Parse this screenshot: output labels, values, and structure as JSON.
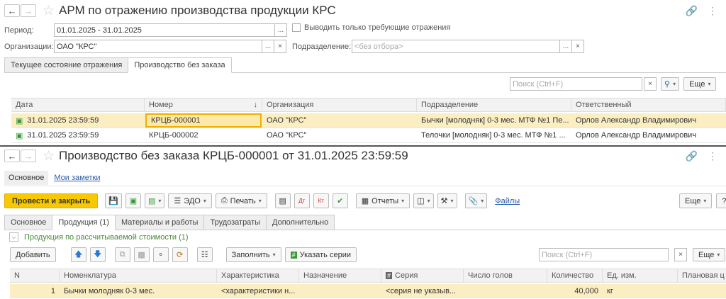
{
  "w1": {
    "title": "АРМ по отражению производства продукции КРС",
    "period_label": "Период:",
    "period_value": "01.01.2025 - 31.01.2025",
    "only_required_label": "Выводить только требующие отражения",
    "org_label": "Организации:",
    "org_value": "ОАО \"КРС\"",
    "dept_label": "Подразделение:",
    "dept_placeholder": "<без отбора>",
    "tabs": [
      "Текущее состояние отражения",
      "Производство без заказа"
    ],
    "search_placeholder": "Поиск (Ctrl+F)",
    "more_label": "Еще",
    "columns": [
      "Дата",
      "Номер",
      "Организация",
      "Подразделение",
      "Ответственный"
    ],
    "rows": [
      {
        "date": "31.01.2025 23:59:59",
        "number": "КРЦБ-000001",
        "org": "ОАО \"КРС\"",
        "dept": "Бычки [молодняк] 0-3 мес. МТФ №1 Пе...",
        "resp": "Орлов Александр Владимирович"
      },
      {
        "date": "31.01.2025 23:59:59",
        "number": "КРЦБ-000002",
        "org": "ОАО \"КРС\"",
        "dept": "Телочки [молодняк] 0-3 мес. МТФ №1 ...",
        "resp": "Орлов Александр Владимирович"
      }
    ]
  },
  "w2": {
    "title": "Производство без заказа КРЦБ-000001 от 31.01.2025 23:59:59",
    "nav": [
      "Основное",
      "Мои заметки"
    ],
    "toolbar": {
      "post_close": "Провести и закрыть",
      "edo": "ЭДО",
      "print": "Печать",
      "reports": "Отчеты",
      "files": "Файлы",
      "more": "Еще",
      "help": "?"
    },
    "tabs": [
      "Основное",
      "Продукция (1)",
      "Материалы и работы",
      "Трудозатраты",
      "Дополнительно"
    ],
    "group_label": "Продукция по рассчитываемой стоимости (1)",
    "grid_toolbar": {
      "add": "Добавить",
      "fill": "Заполнить",
      "series": "Указать серии",
      "search_placeholder": "Поиск (Ctrl+F)",
      "more": "Еще"
    },
    "columns": [
      "N",
      "Номенклатура",
      "Характеристика",
      "Назначение",
      "Серия",
      "Число голов",
      "Количество",
      "Ед. изм.",
      "Плановая ц"
    ],
    "rows": [
      {
        "n": "1",
        "item": "Бычки молодняк 0-3 мес.",
        "char": "<характеристики н...",
        "purpose": "",
        "series": "<серия не указыв...",
        "heads": "",
        "qty": "40,000",
        "unit": "кг",
        "plan": ""
      }
    ]
  }
}
